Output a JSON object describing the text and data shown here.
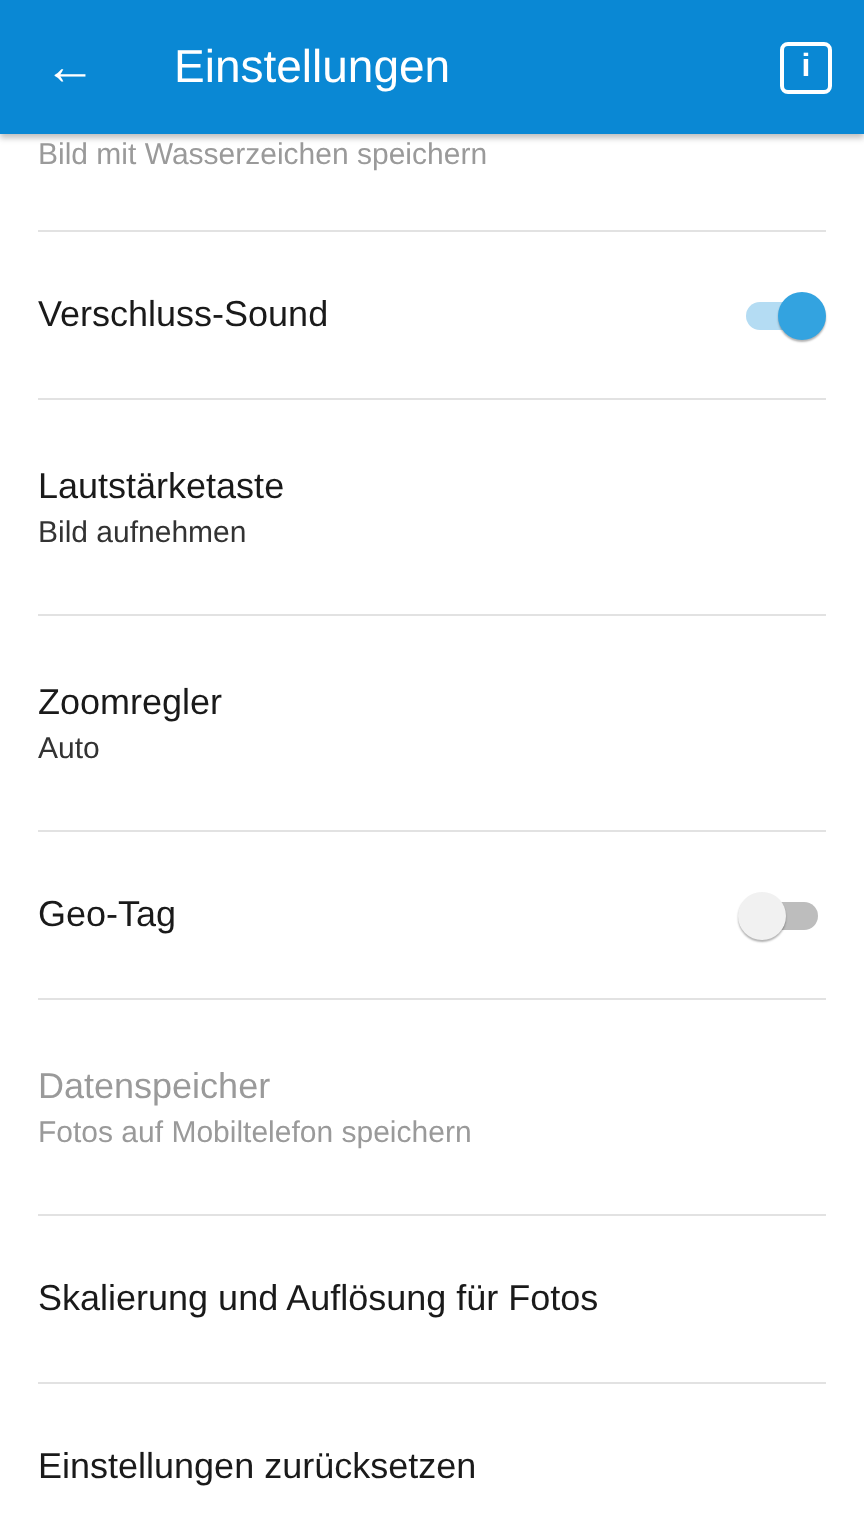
{
  "app_bar": {
    "back_label": "←",
    "title": "Einstellungen",
    "info_label": "i"
  },
  "settings": [
    {
      "kind": "partial",
      "subtitle": "Bild mit Wasserzeichen speichern",
      "disabled": true
    },
    {
      "kind": "toggle",
      "title": "Verschluss-Sound",
      "on": true,
      "disabled": false
    },
    {
      "kind": "value",
      "title": "Lautstärketaste",
      "subtitle": "Bild aufnehmen",
      "disabled": false
    },
    {
      "kind": "value",
      "title": "Zoomregler",
      "subtitle": "Auto",
      "disabled": false
    },
    {
      "kind": "toggle",
      "title": "Geo-Tag",
      "on": false,
      "disabled": false
    },
    {
      "kind": "value",
      "title": "Datenspeicher",
      "subtitle": "Fotos auf Mobiltelefon speichern",
      "disabled": true
    },
    {
      "kind": "plain",
      "title": "Skalierung und Auflösung für Fotos",
      "disabled": false
    },
    {
      "kind": "plain",
      "title": "Einstellungen zurücksetzen",
      "disabled": false
    }
  ]
}
